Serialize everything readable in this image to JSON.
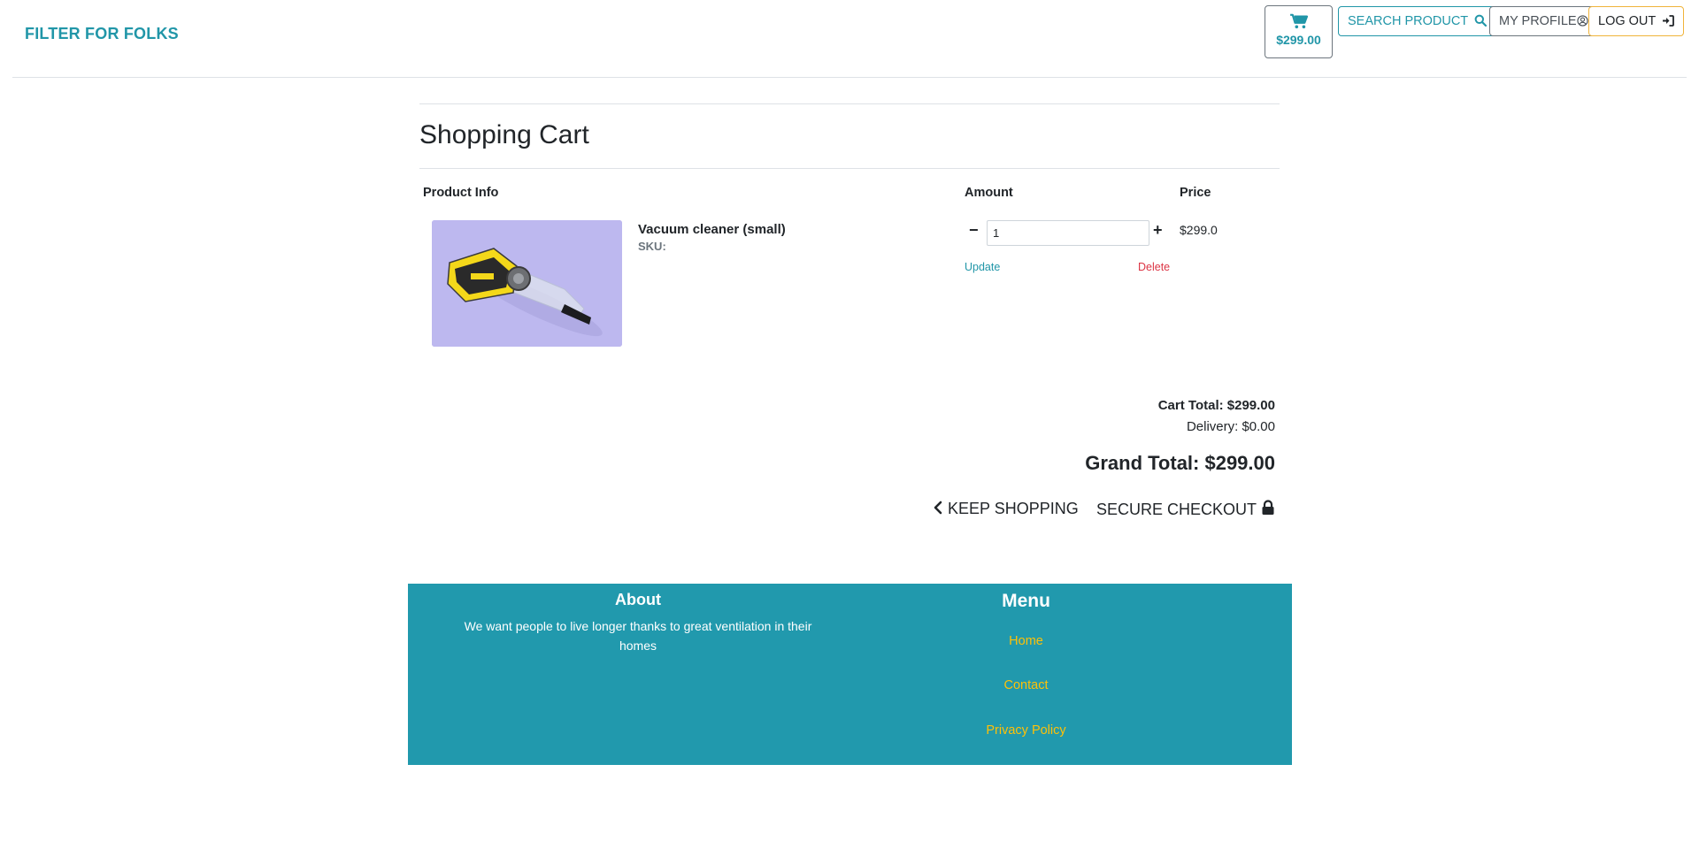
{
  "brand": "FILTER FOR FOLKS",
  "header": {
    "cart_total": "$299.00",
    "search_label": "SEARCH PRODUCT",
    "profile_label": "MY PROFILE",
    "logout_label": "LOG OUT"
  },
  "page_title": "Shopping Cart",
  "columns": {
    "product": "Product Info",
    "amount": "Amount",
    "price": "Price"
  },
  "cart_items": [
    {
      "name": "Vacuum cleaner (small)",
      "sku_label": "SKU:",
      "quantity": "1",
      "price": "$299.0",
      "update_label": "Update",
      "delete_label": "Delete",
      "minus": "−",
      "plus": "+"
    }
  ],
  "summary": {
    "cart_total": "Cart Total: $299.00",
    "delivery": "Delivery: $0.00",
    "grand_total": "Grand Total: $299.00"
  },
  "actions": {
    "keep_shopping": "KEEP SHOPPING",
    "secure_checkout": "SECURE CHECKOUT"
  },
  "footer": {
    "about_title": "About",
    "about_text": "We want people to live longer thanks to great ventilation in their homes",
    "menu_title": "Menu",
    "menu_links": [
      "Home",
      "Contact",
      "Privacy Policy"
    ]
  },
  "colors": {
    "brand": "#2196a8",
    "footer_bg": "#2199ad",
    "footer_link": "#ffc107",
    "delete": "#dc3545",
    "logout_border": "#f0b43a"
  },
  "icons": [
    "cart-icon",
    "search-icon",
    "user-circle-icon",
    "sign-out-icon",
    "chevron-left-icon",
    "lock-icon"
  ]
}
